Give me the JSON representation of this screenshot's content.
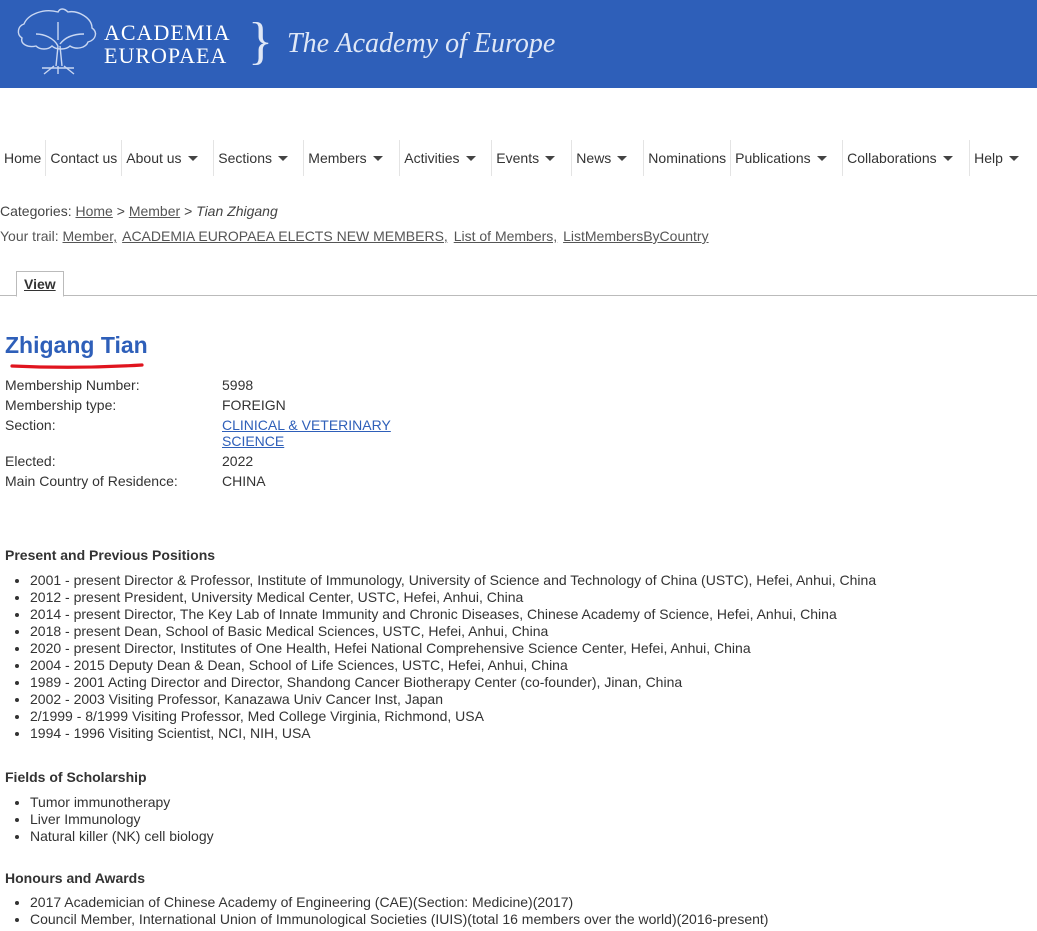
{
  "header": {
    "brand_line1": "ACADEMIA",
    "brand_line2": "EUROPAEA",
    "brace": "}",
    "tagline": "The Academy of Europe",
    "banner_color": "#2e5fb9"
  },
  "nav": {
    "items": [
      {
        "label": "Home",
        "dropdown": false
      },
      {
        "label": "Contact us",
        "dropdown": false
      },
      {
        "label": "About us",
        "dropdown": true
      },
      {
        "label": "Sections",
        "dropdown": true
      },
      {
        "label": "Members",
        "dropdown": true
      },
      {
        "label": "Activities",
        "dropdown": true
      },
      {
        "label": "Events",
        "dropdown": true
      },
      {
        "label": "News",
        "dropdown": true
      },
      {
        "label": "Nominations",
        "dropdown": false
      },
      {
        "label": "Publications",
        "dropdown": true
      },
      {
        "label": "Collaborations",
        "dropdown": true
      },
      {
        "label": "Help",
        "dropdown": true
      }
    ]
  },
  "breadcrumb": {
    "prefix": "Categories:",
    "home": "Home",
    "sep": ">",
    "member": "Member",
    "current": "Tian Zhigang"
  },
  "trail": {
    "prefix": "Your trail:",
    "links": [
      "Member,",
      "ACADEMIA EUROPAEA ELECTS NEW MEMBERS,",
      "List of Members,",
      "ListMembersByCountry"
    ]
  },
  "tabs": {
    "view": "View"
  },
  "person": {
    "name": "Zhigang Tian",
    "fields": [
      {
        "label": "Membership Number:",
        "value": "5998",
        "link": false
      },
      {
        "label": "Membership type:",
        "value": "FOREIGN",
        "link": false
      },
      {
        "label": "Section:",
        "value": "CLINICAL & VETERINARY SCIENCE",
        "link": true
      },
      {
        "label": "Elected:",
        "value": "2022",
        "link": false
      },
      {
        "label": "Main Country of Residence:",
        "value": "CHINA",
        "link": false
      }
    ]
  },
  "positions": {
    "heading": "Present and Previous Positions",
    "items": [
      "2001 - present Director & Professor, Institute of Immunology, University of Science and Technology of China (USTC), Hefei, Anhui, China",
      "2012 - present President, University Medical Center, USTC, Hefei, Anhui, China",
      "2014 - present Director, The Key Lab of Innate Immunity and Chronic Diseases, Chinese Academy of Science, Hefei, Anhui, China",
      "2018 - present Dean, School of Basic Medical Sciences, USTC, Hefei, Anhui, China",
      "2020 - present Director, Institutes of One Health, Hefei National Comprehensive Science Center, Hefei, Anhui, China",
      "2004 - 2015 Deputy Dean & Dean, School of Life Sciences, USTC, Hefei, Anhui, China",
      "1989 - 2001 Acting Director and Director, Shandong Cancer Biotherapy Center (co-founder), Jinan, China",
      "2002 - 2003 Visiting Professor, Kanazawa Univ Cancer Inst, Japan",
      "2/1999 - 8/1999 Visiting Professor, Med College Virginia, Richmond, USA",
      "1994 - 1996 Visiting Scientist, NCI, NIH, USA"
    ]
  },
  "fields_of_scholarship": {
    "heading": "Fields of Scholarship",
    "items": [
      "Tumor immunotherapy",
      "Liver Immunology",
      "Natural killer (NK) cell biology"
    ]
  },
  "honours": {
    "heading": "Honours and Awards",
    "items": [
      "2017 Academician of Chinese Academy of Engineering (CAE)(Section: Medicine)(2017)",
      "Council Member, International Union of Immunological Societies (IUIS)(total 16 members over the world)(2016-present)"
    ]
  },
  "colors": {
    "title_blue": "#2e5fb9",
    "underline_red": "#e0141e"
  }
}
